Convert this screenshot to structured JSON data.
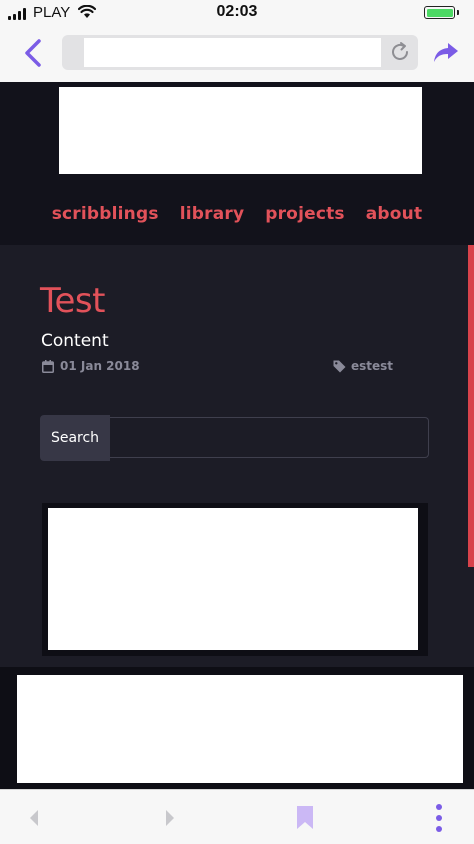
{
  "status_bar": {
    "carrier": "PLAY",
    "time": "02:03",
    "battery_level": 1.0,
    "icons": [
      "signal-icon",
      "wifi-icon",
      "battery-icon"
    ]
  },
  "browser": {
    "url_value": "",
    "icons": [
      "back-arrow-icon",
      "reload-icon",
      "share-icon",
      "bookmark-icon",
      "more-icon"
    ]
  },
  "site": {
    "nav": [
      "scribblings",
      "library",
      "projects",
      "about"
    ]
  },
  "post": {
    "title": "Test",
    "content": "Content",
    "date": "01 Jan 2018",
    "tag": "estest"
  },
  "search": {
    "button_label": "Search",
    "value": ""
  },
  "colors": {
    "accent": "#e2525a",
    "page_bg": "#1c1c26",
    "header_bg": "#12121b",
    "meta_text": "#8a8a99",
    "ios_purple": "#7b5ce6"
  }
}
